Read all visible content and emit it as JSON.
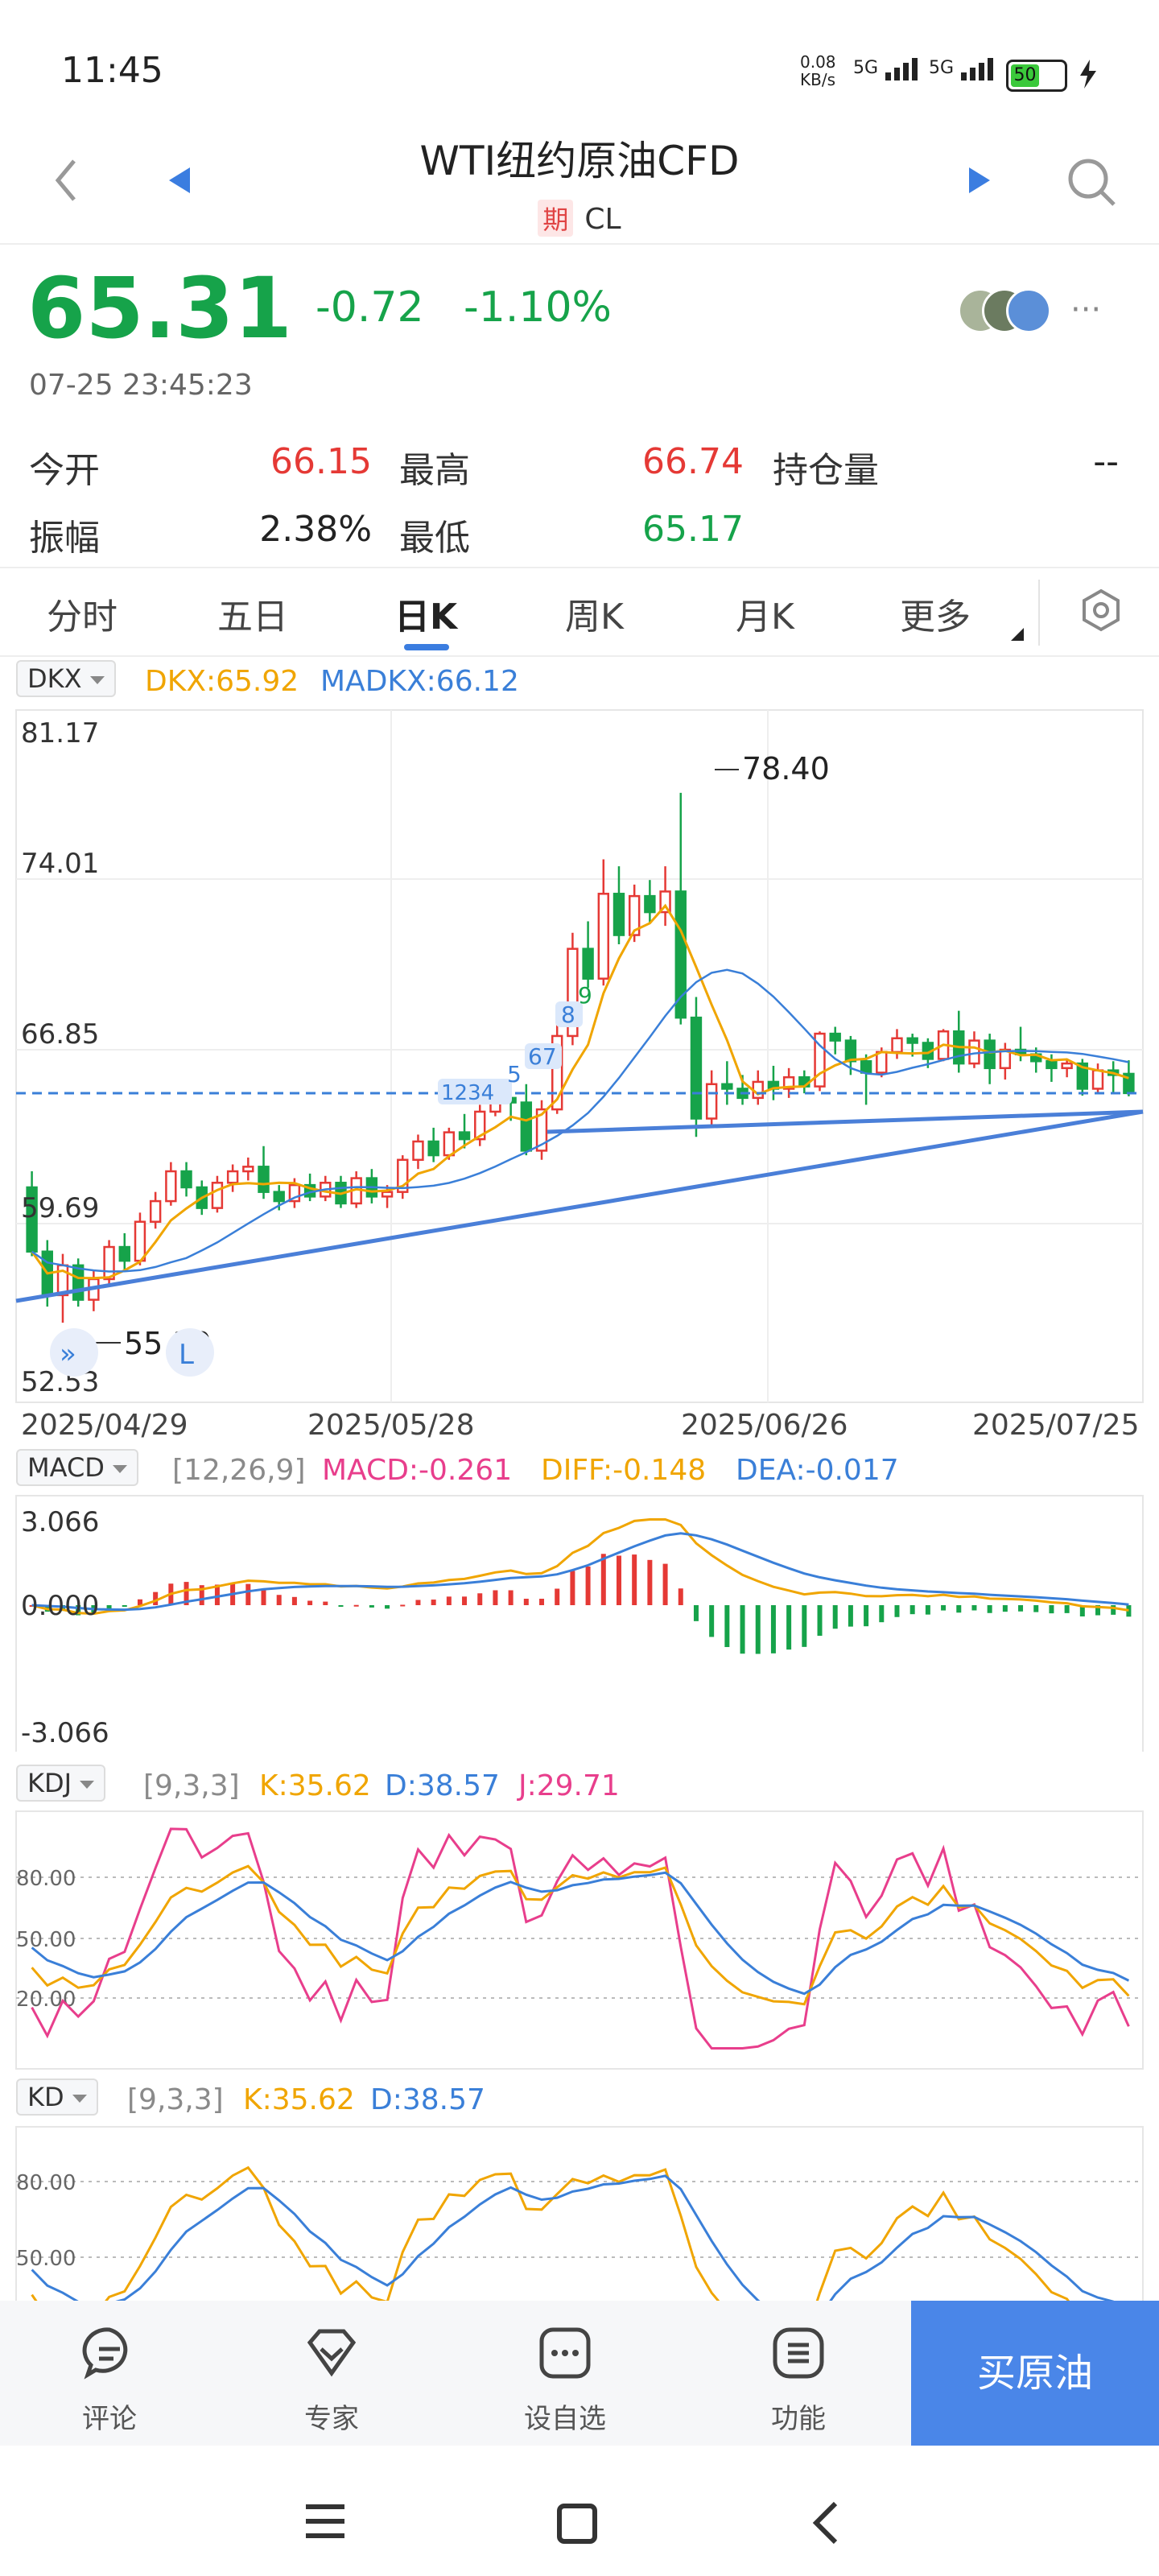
{
  "status": {
    "time": "11:45",
    "net_speed_value": "0.08",
    "net_speed_unit": "KB/s",
    "sig1": "5G",
    "sig2": "5G",
    "battery": "50"
  },
  "header": {
    "title": "WTI纽约原油CFD",
    "badge": "期",
    "symbol": "CL"
  },
  "quote": {
    "price": "65.31",
    "change": "-0.72",
    "change_pct": "-1.10%",
    "timestamp": "07-25 23:45:23"
  },
  "stats": {
    "open_label": "今开",
    "open": "66.15",
    "high_label": "最高",
    "high": "66.74",
    "oi_label": "持仓量",
    "oi": "--",
    "amp_label": "振幅",
    "amp": "2.38%",
    "low_label": "最低",
    "low": "65.17"
  },
  "tabs": [
    "分时",
    "五日",
    "日K",
    "周K",
    "月K",
    "更多"
  ],
  "main_chart": {
    "indicator": "DKX",
    "dkx": "DKX:65.92",
    "madkx": "MADKX:66.12",
    "y_labels": [
      "81.17",
      "74.01",
      "66.85",
      "59.69",
      "52.53"
    ],
    "x_labels": [
      "2025/04/29",
      "2025/05/28",
      "2025/06/26",
      "2025/07/25"
    ],
    "high_mark": "78.40",
    "low_mark": "55.30",
    "seq_labels": [
      "1234",
      "5",
      "67",
      "8",
      "9"
    ]
  },
  "macd": {
    "indicator": "MACD",
    "params": "[12,26,9]",
    "macd": "MACD:-0.261",
    "diff": "DIFF:-0.148",
    "dea": "DEA:-0.017",
    "y_labels": [
      "3.066",
      "0.000",
      "-3.066"
    ]
  },
  "kdj": {
    "indicator": "KDJ",
    "params": "[9,3,3]",
    "k": "K:35.62",
    "d": "D:38.57",
    "j": "J:29.71",
    "y_labels": [
      "80.00",
      "50.00",
      "20.00"
    ]
  },
  "kd": {
    "indicator": "KD",
    "params": "[9,3,3]",
    "k": "K:35.62",
    "d": "D:38.57",
    "y_labels": [
      "80.00",
      "50.00"
    ]
  },
  "bottom": {
    "items": [
      "评论",
      "专家",
      "设自选",
      "功能"
    ],
    "buy": "买原油"
  },
  "chart_data": {
    "type": "candlestick",
    "title": "WTI纽约原油CFD",
    "x_range": [
      "2025/04/29",
      "2025/07/25"
    ],
    "ylim": [
      52.53,
      81.17
    ],
    "series": [
      {
        "name": "DKX",
        "last": 65.92
      },
      {
        "name": "MADKX",
        "last": 66.12
      }
    ],
    "annotations": {
      "high": 78.4,
      "low": 55.3,
      "last_price": 65.31
    },
    "candles": [
      [
        61.2,
        58.4,
        61.9,
        58.2
      ],
      [
        58.4,
        56.5,
        58.9,
        56.0
      ],
      [
        56.5,
        57.8,
        58.3,
        55.3
      ],
      [
        57.8,
        56.3,
        58.1,
        56.0
      ],
      [
        56.3,
        57.2,
        57.6,
        55.8
      ],
      [
        57.2,
        58.6,
        58.9,
        57.0
      ],
      [
        58.6,
        58.0,
        59.2,
        57.6
      ],
      [
        58.0,
        59.7,
        60.1,
        57.8
      ],
      [
        59.7,
        60.6,
        61.0,
        59.4
      ],
      [
        60.6,
        61.9,
        62.3,
        60.4
      ],
      [
        61.9,
        61.2,
        62.3,
        60.8
      ],
      [
        61.2,
        60.3,
        61.5,
        60.0
      ],
      [
        60.3,
        61.4,
        61.7,
        60.1
      ],
      [
        61.4,
        61.9,
        62.2,
        61.0
      ],
      [
        61.9,
        62.1,
        62.5,
        61.5
      ],
      [
        62.1,
        61.0,
        63.0,
        60.7
      ],
      [
        61.0,
        60.6,
        61.3,
        60.2
      ],
      [
        60.6,
        61.3,
        61.6,
        60.3
      ],
      [
        61.3,
        60.8,
        61.8,
        60.6
      ],
      [
        60.8,
        61.4,
        61.7,
        60.6
      ],
      [
        61.4,
        60.5,
        61.7,
        60.3
      ],
      [
        60.5,
        61.6,
        61.9,
        60.3
      ],
      [
        61.6,
        60.8,
        62.0,
        60.5
      ],
      [
        60.8,
        61.0,
        61.3,
        60.3
      ],
      [
        61.0,
        62.4,
        62.6,
        60.7
      ],
      [
        62.4,
        63.2,
        63.5,
        62.0
      ],
      [
        63.2,
        62.6,
        63.8,
        62.3
      ],
      [
        62.6,
        63.6,
        63.8,
        62.4
      ],
      [
        63.6,
        63.3,
        64.4,
        62.9
      ],
      [
        63.3,
        64.5,
        64.8,
        63.0
      ],
      [
        64.5,
        65.1,
        65.8,
        64.3
      ],
      [
        65.1,
        64.9,
        65.4,
        64.1
      ],
      [
        64.9,
        62.8,
        65.7,
        62.6
      ],
      [
        62.8,
        64.6,
        65.0,
        62.4
      ],
      [
        64.6,
        67.8,
        68.6,
        64.4
      ],
      [
        67.8,
        71.6,
        72.3,
        67.4
      ],
      [
        71.6,
        70.3,
        72.8,
        69.9
      ],
      [
        70.3,
        74.0,
        75.5,
        70.0
      ],
      [
        74.0,
        72.2,
        75.2,
        71.8
      ],
      [
        72.2,
        73.9,
        74.4,
        71.9
      ],
      [
        73.9,
        73.2,
        74.6,
        72.7
      ],
      [
        73.2,
        74.1,
        75.2,
        72.6
      ],
      [
        74.1,
        68.6,
        78.4,
        68.3
      ],
      [
        68.6,
        64.2,
        69.5,
        63.4
      ],
      [
        64.2,
        65.7,
        66.3,
        63.9
      ],
      [
        65.7,
        65.5,
        66.7,
        64.8
      ],
      [
        65.5,
        65.1,
        66.1,
        64.8
      ],
      [
        65.1,
        65.8,
        66.3,
        64.8
      ],
      [
        65.8,
        65.5,
        66.5,
        65.0
      ],
      [
        65.5,
        66.0,
        66.4,
        65.1
      ],
      [
        66.0,
        65.6,
        66.3,
        65.3
      ],
      [
        65.6,
        67.9,
        68.0,
        65.4
      ],
      [
        67.9,
        67.6,
        68.2,
        67.0
      ],
      [
        67.6,
        66.7,
        67.8,
        66.1
      ],
      [
        66.7,
        66.2,
        67.0,
        64.8
      ],
      [
        66.2,
        67.1,
        67.3,
        66.0
      ],
      [
        67.1,
        67.7,
        68.1,
        66.8
      ],
      [
        67.7,
        67.5,
        67.9,
        66.9
      ],
      [
        67.5,
        66.8,
        67.7,
        66.4
      ],
      [
        66.8,
        68.0,
        68.1,
        66.7
      ],
      [
        68.0,
        66.6,
        68.9,
        66.2
      ],
      [
        66.6,
        67.6,
        68.0,
        66.4
      ],
      [
        67.6,
        66.4,
        67.9,
        65.7
      ],
      [
        66.4,
        67.2,
        67.5,
        65.9
      ],
      [
        67.2,
        67.0,
        68.2,
        66.7
      ],
      [
        67.0,
        66.7,
        67.3,
        66.2
      ],
      [
        66.7,
        66.4,
        67.0,
        65.8
      ],
      [
        66.4,
        66.6,
        66.8,
        66.0
      ],
      [
        66.6,
        65.5,
        66.8,
        65.2
      ],
      [
        65.5,
        66.3,
        66.6,
        65.3
      ],
      [
        66.3,
        66.1,
        66.7,
        65.3
      ],
      [
        66.15,
        65.31,
        66.74,
        65.17
      ]
    ]
  }
}
